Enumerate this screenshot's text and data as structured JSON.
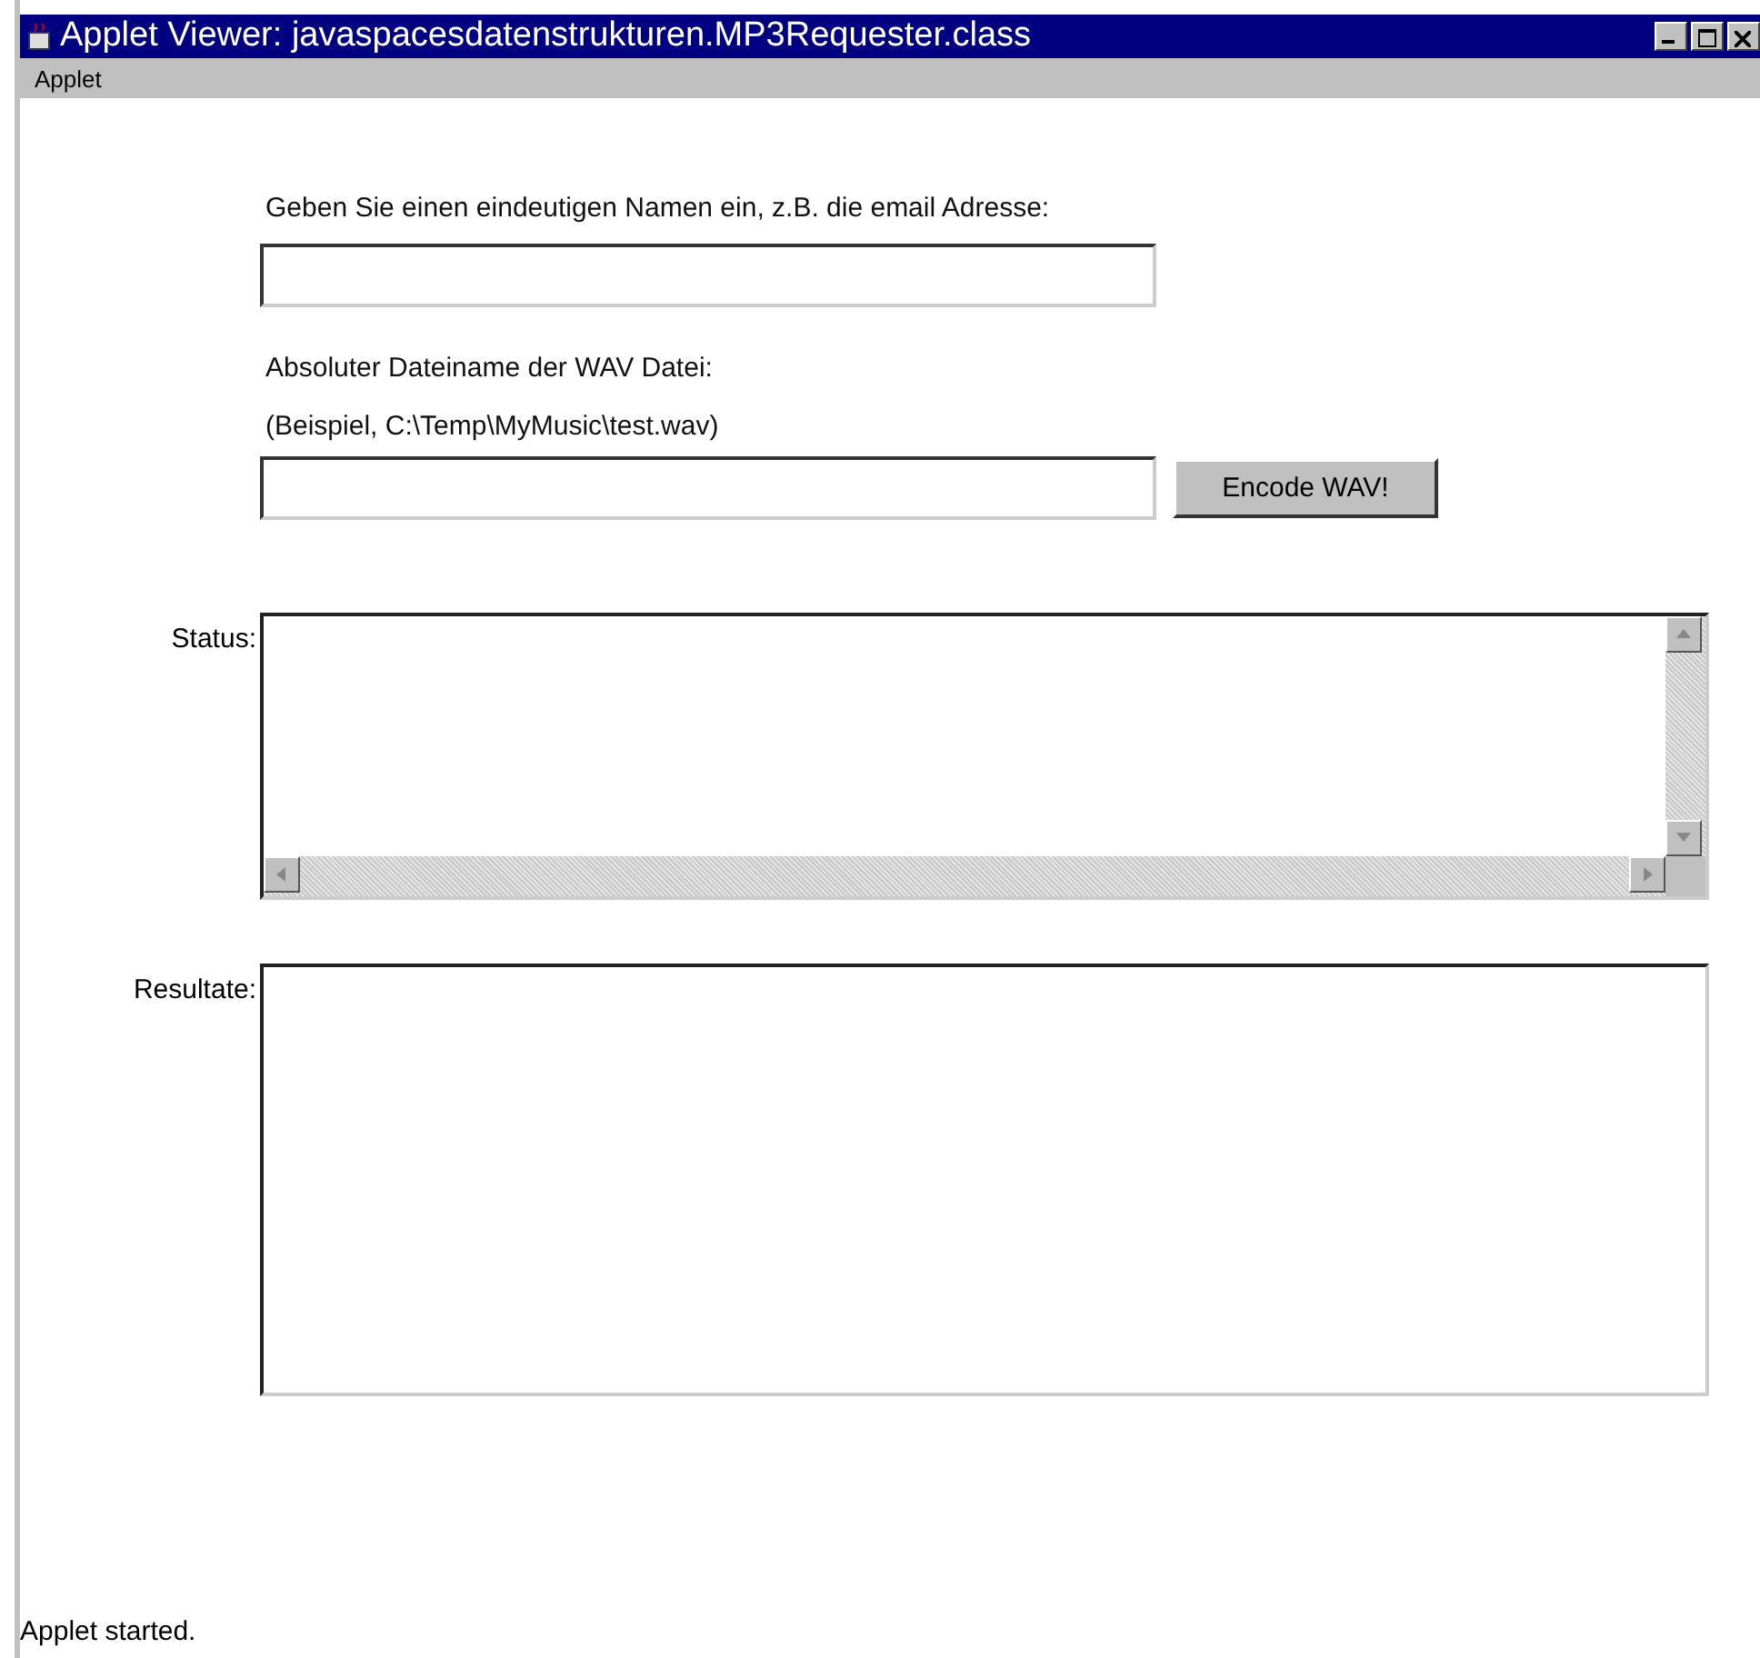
{
  "window": {
    "title": "Applet Viewer: javaspacesdatenstrukturen.MP3Requester.class"
  },
  "menu_bar": [
    "Applet"
  ],
  "form": {
    "name_label": "Geben Sie einen eindeutigen Namen ein, z.B. die email Adresse:",
    "file_label": "Absoluter Dateiname der WAV Datei:",
    "file_hint": "(Beispiel, C:\\Temp\\MyMusic\\test.wav)",
    "encode_button": "Encode WAV!",
    "status_label": "Status:",
    "results_label": "Resultate:"
  },
  "status_bar": "Applet started."
}
